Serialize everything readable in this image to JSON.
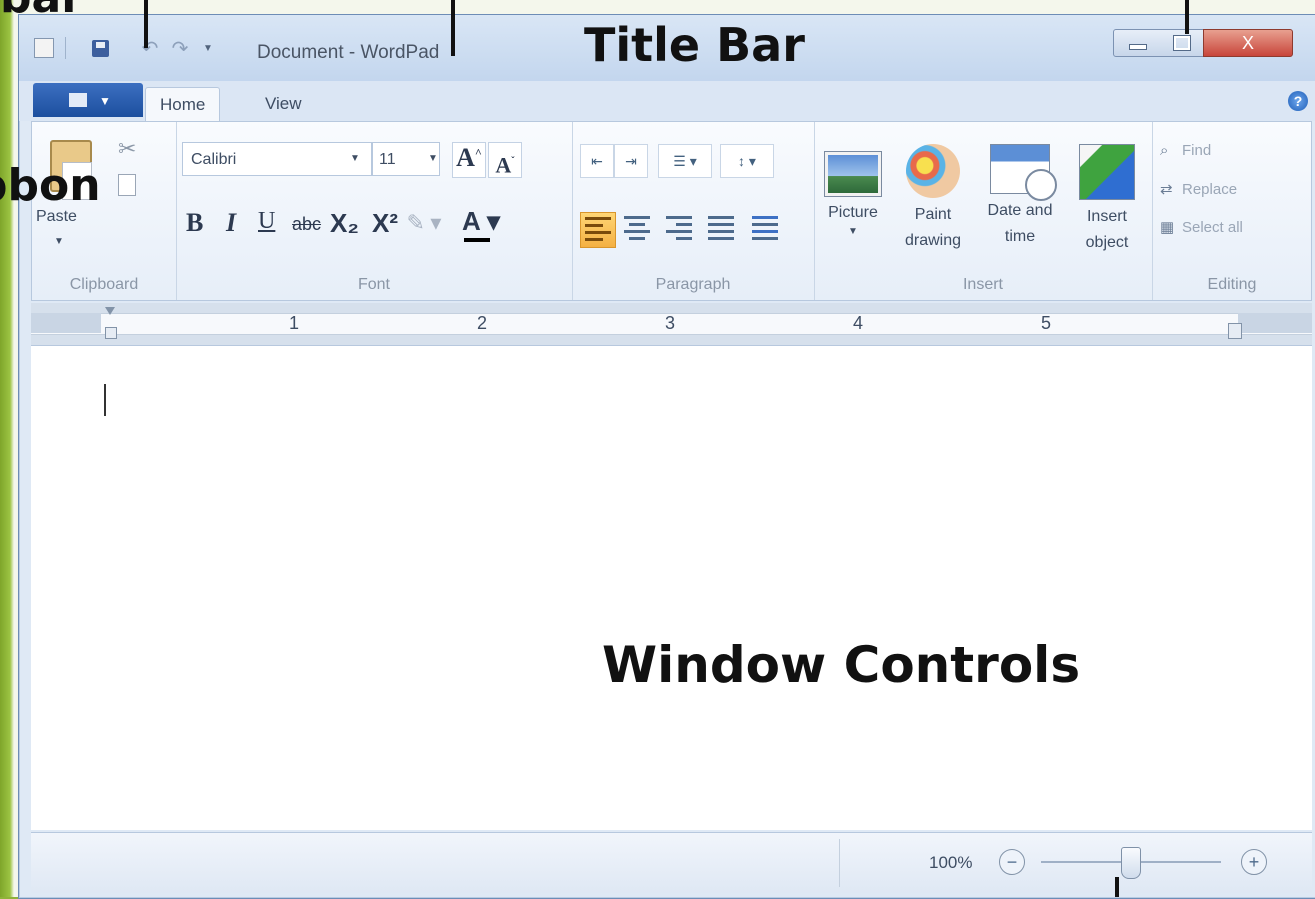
{
  "callouts": {
    "toolbar": "bar",
    "ribbon": "bbon",
    "title_bar": "Title Bar",
    "window_controls": "Window Controls"
  },
  "titlebar": {
    "title": "Document - WordPad",
    "close_glyph": "X",
    "qat_icons": [
      "app-icon",
      "save-icon",
      "undo-icon",
      "redo-icon",
      "customize-dropdown-icon"
    ]
  },
  "tabs": [
    {
      "label": "Home",
      "selected": true
    },
    {
      "label": "View",
      "selected": false
    }
  ],
  "help_glyph": "?",
  "ribbon": {
    "clipboard": {
      "label": "Clipboard",
      "paste": "Paste"
    },
    "font": {
      "label": "Font",
      "font_name": "Calibri",
      "font_size": "11",
      "bold": "B",
      "italic": "I",
      "underline": "U",
      "strike": "abc",
      "subscript": "X₂",
      "superscript": "X²",
      "font_color": "A"
    },
    "paragraph": {
      "label": "Paragraph"
    },
    "insert": {
      "label": "Insert",
      "picture": "Picture",
      "paint": "Paint drawing",
      "datetime": "Date and time",
      "object": "Insert object"
    },
    "editing": {
      "label": "Editing",
      "find": "Find",
      "replace": "Replace",
      "select_all": "Select all"
    }
  },
  "ruler": {
    "numbers": [
      "1",
      "2",
      "3",
      "4",
      "5"
    ]
  },
  "status": {
    "zoom": "100%",
    "zoom_minus": "−",
    "zoom_plus": "+"
  },
  "colors": {
    "accent": "#1c4f9e",
    "slide_green": "#8fb23a",
    "close_red": "#c8453a",
    "align_active": "#f4b043"
  }
}
